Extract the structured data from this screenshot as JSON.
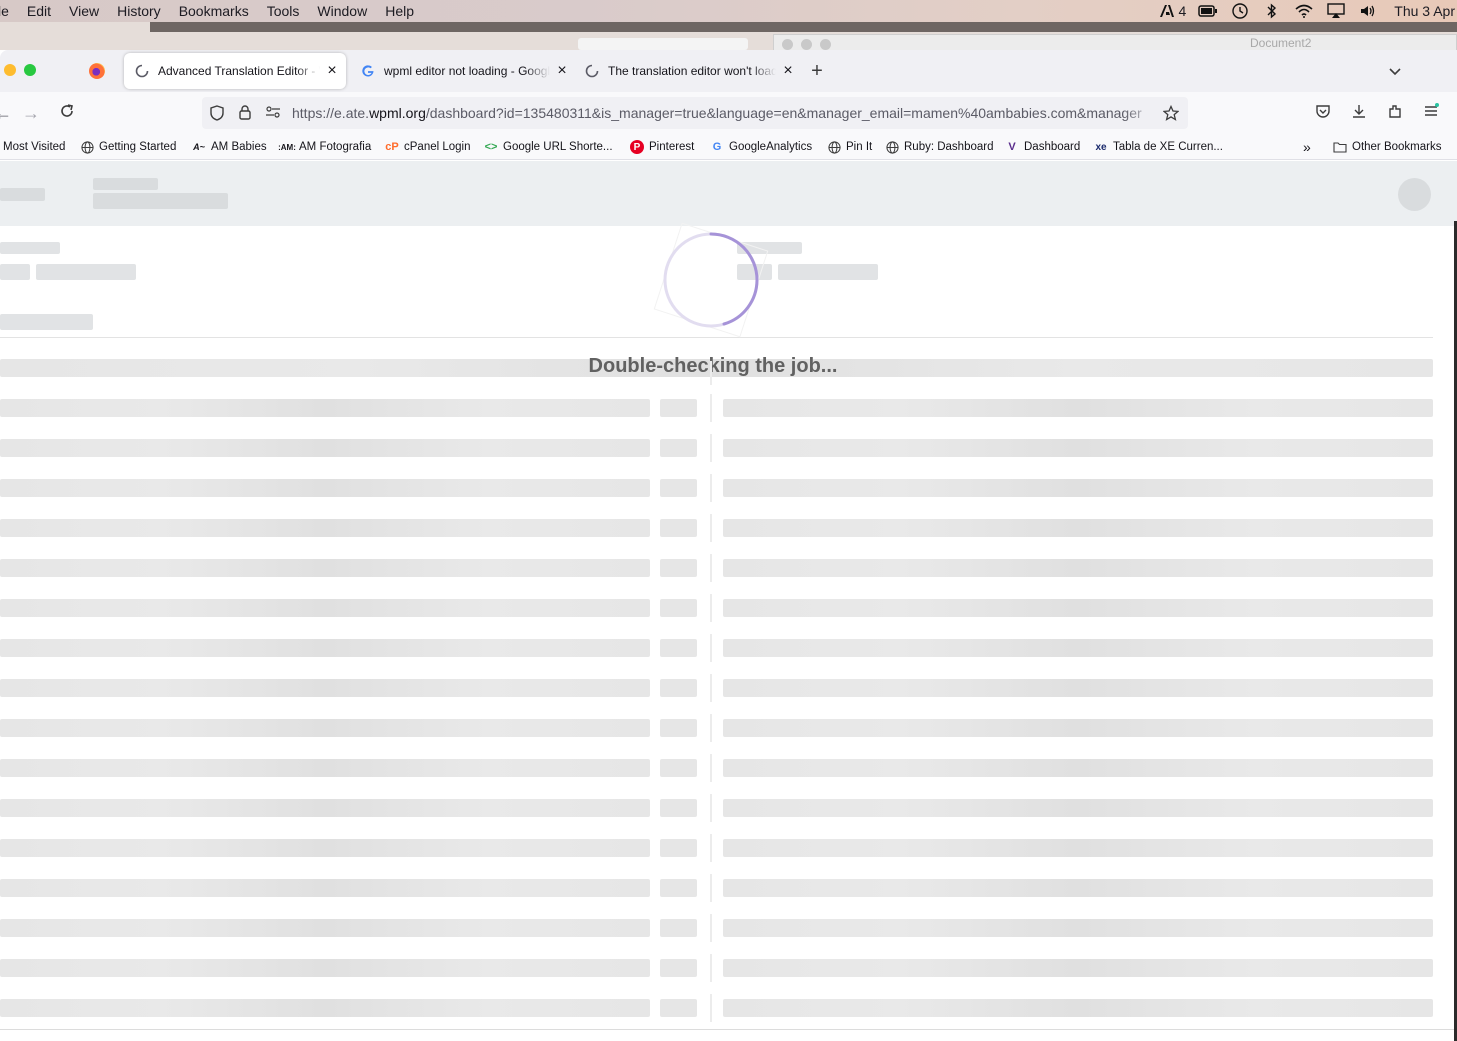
{
  "menubar": {
    "items": [
      "le",
      "Edit",
      "View",
      "History",
      "Bookmarks",
      "Tools",
      "Window",
      "Help"
    ],
    "status_battery_count": "4",
    "clock": "Thu 3 Apr"
  },
  "background_window": {
    "title": "Document2"
  },
  "browser": {
    "tabs": [
      {
        "title": "Advanced Translation Editor - WPML",
        "active": true,
        "icon": "loading-icon"
      },
      {
        "title": "wpml editor not loading - Google Search",
        "active": false,
        "icon": "google-icon"
      },
      {
        "title": "The translation editor won't load",
        "active": false,
        "icon": "loading-icon"
      }
    ],
    "url": {
      "prefix": "https://e.ate.",
      "domain": "wpml.org",
      "rest": "/dashboard?id=135480311&is_manager=true&language=en&manager_email=mamen%40ambabies.com&manager"
    },
    "bookmarks": [
      {
        "label": "Most Visited",
        "icon": "none"
      },
      {
        "label": "Getting Started",
        "icon": "globe-icon"
      },
      {
        "label": "AM Babies",
        "icon": "am-babies-icon"
      },
      {
        "label": "AM Fotografia",
        "icon": "am-fotografia-icon"
      },
      {
        "label": "cPanel Login",
        "icon": "cpanel-icon"
      },
      {
        "label": "Google URL Shorte...",
        "icon": "google-shortener-icon"
      },
      {
        "label": "Pinterest",
        "icon": "pinterest-icon"
      },
      {
        "label": "GoogleAnalytics",
        "icon": "google-icon"
      },
      {
        "label": "Pin It",
        "icon": "globe-icon"
      },
      {
        "label": "Ruby: Dashboard",
        "icon": "globe-icon"
      },
      {
        "label": "Dashboard",
        "icon": "dashboard-icon"
      },
      {
        "label": "Tabla de XE Curren...",
        "icon": "xe-icon"
      }
    ],
    "other_bookmarks": "Other Bookmarks"
  },
  "page": {
    "loading_message": "Double-checking the job...",
    "colors": {
      "spinner": "#9b86d4",
      "header_bg": "#eceff1",
      "skeleton": "#e6e6e6"
    }
  }
}
